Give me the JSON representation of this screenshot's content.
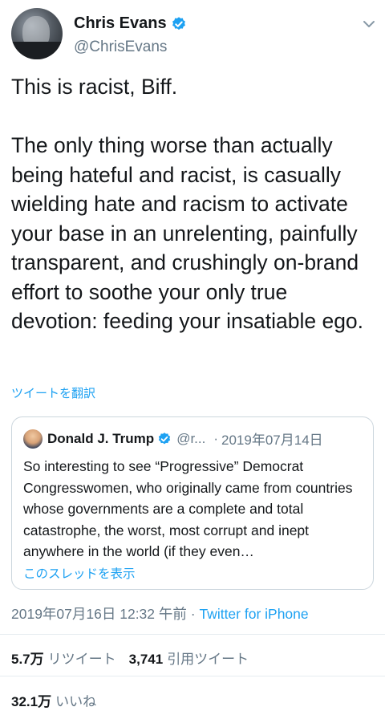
{
  "author": {
    "name": "Chris Evans",
    "handle": "@ChrisEvans",
    "verified_color": "#1da1f2"
  },
  "tweet": {
    "text": "This is racist, Biff.\n\nThe only thing worse than actually being hateful and racist, is casually wielding hate and racism to activate your base in an unrelenting, painfully transparent, and crushingly on-brand effort to soothe your only true devotion: feeding your insatiable ego.",
    "translate_label": "ツイートを翻訳"
  },
  "quoted": {
    "name": "Donald J. Trump",
    "handle": "@r...",
    "separator": "·",
    "date": "2019年07月14日",
    "text": "So interesting to see “Progressive” Democrat Congresswomen, who originally came from countries whose governments are a complete and total catastrophe, the worst, most corrupt and inept anywhere in the world (if they even…",
    "thread_label": "このスレッドを表示"
  },
  "meta": {
    "timestamp": "2019年07月16日 12:32 午前",
    "separator": " · ",
    "client": "Twitter for iPhone"
  },
  "stats": {
    "retweets_count": "5.7万",
    "retweets_label": "リツイート",
    "quotes_count": "3,741",
    "quotes_label": "引用ツイート",
    "likes_count": "32.1万",
    "likes_label": "いいね"
  },
  "colors": {
    "accent": "#1da1f2",
    "secondary_text": "#657786",
    "border": "#ccd6dd"
  }
}
